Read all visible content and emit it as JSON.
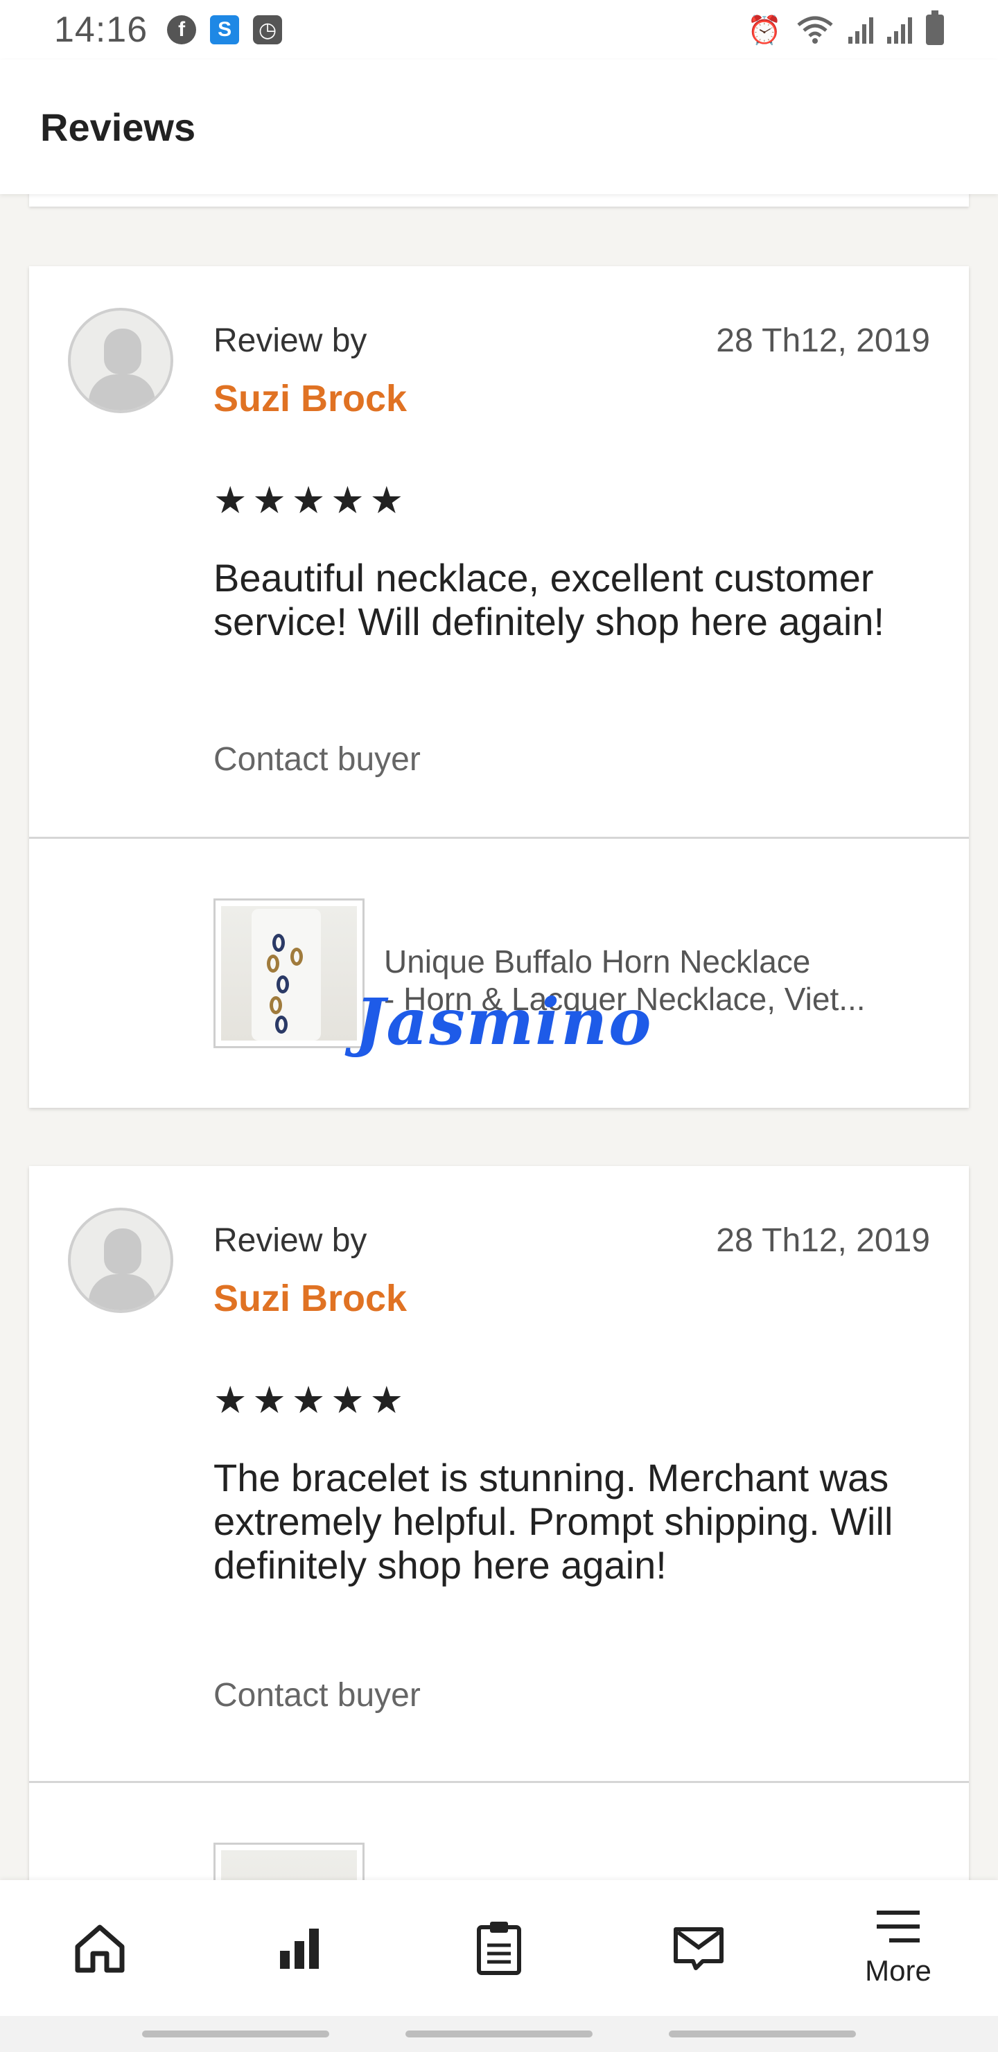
{
  "status_bar": {
    "time": "14:16",
    "left_icons": [
      "facebook-icon",
      "s-app-icon",
      "clock-app-icon"
    ],
    "right_icons": [
      "alarm-icon",
      "wifi-icon",
      "signal-icon",
      "signal-icon",
      "battery-icon"
    ]
  },
  "header": {
    "title": "Reviews"
  },
  "reviews": [
    {
      "label": "Review by",
      "reviewer": "Suzi Brock",
      "date": "28 Th12, 2019",
      "stars": "★★★★★",
      "rating": 5,
      "text": "Beautiful necklace, excellent customer service!  Will definitely shop here again!",
      "contact": "Contact buyer",
      "item": {
        "title_line1": "Unique Buffalo Horn Necklace",
        "title_line2": "- Horn & Lacquer Necklace, Viet...",
        "watermark": "Jasmino"
      }
    },
    {
      "label": "Review by",
      "reviewer": "Suzi Brock",
      "date": "28 Th12, 2019",
      "stars": "★★★★★",
      "rating": 5,
      "text": "The bracelet is stunning.  Merchant was extremely helpful.  Prompt shipping.  Will definitely shop here again!",
      "contact": "Contact buyer"
    }
  ],
  "bottom_nav": {
    "items": [
      {
        "icon": "home-icon"
      },
      {
        "icon": "stats-icon"
      },
      {
        "icon": "orders-icon"
      },
      {
        "icon": "messages-icon"
      },
      {
        "icon": "menu-icon",
        "label": "More"
      }
    ]
  },
  "colors": {
    "accent": "#e07223",
    "watermark": "#1e5be8",
    "background": "#f5f4f1"
  }
}
